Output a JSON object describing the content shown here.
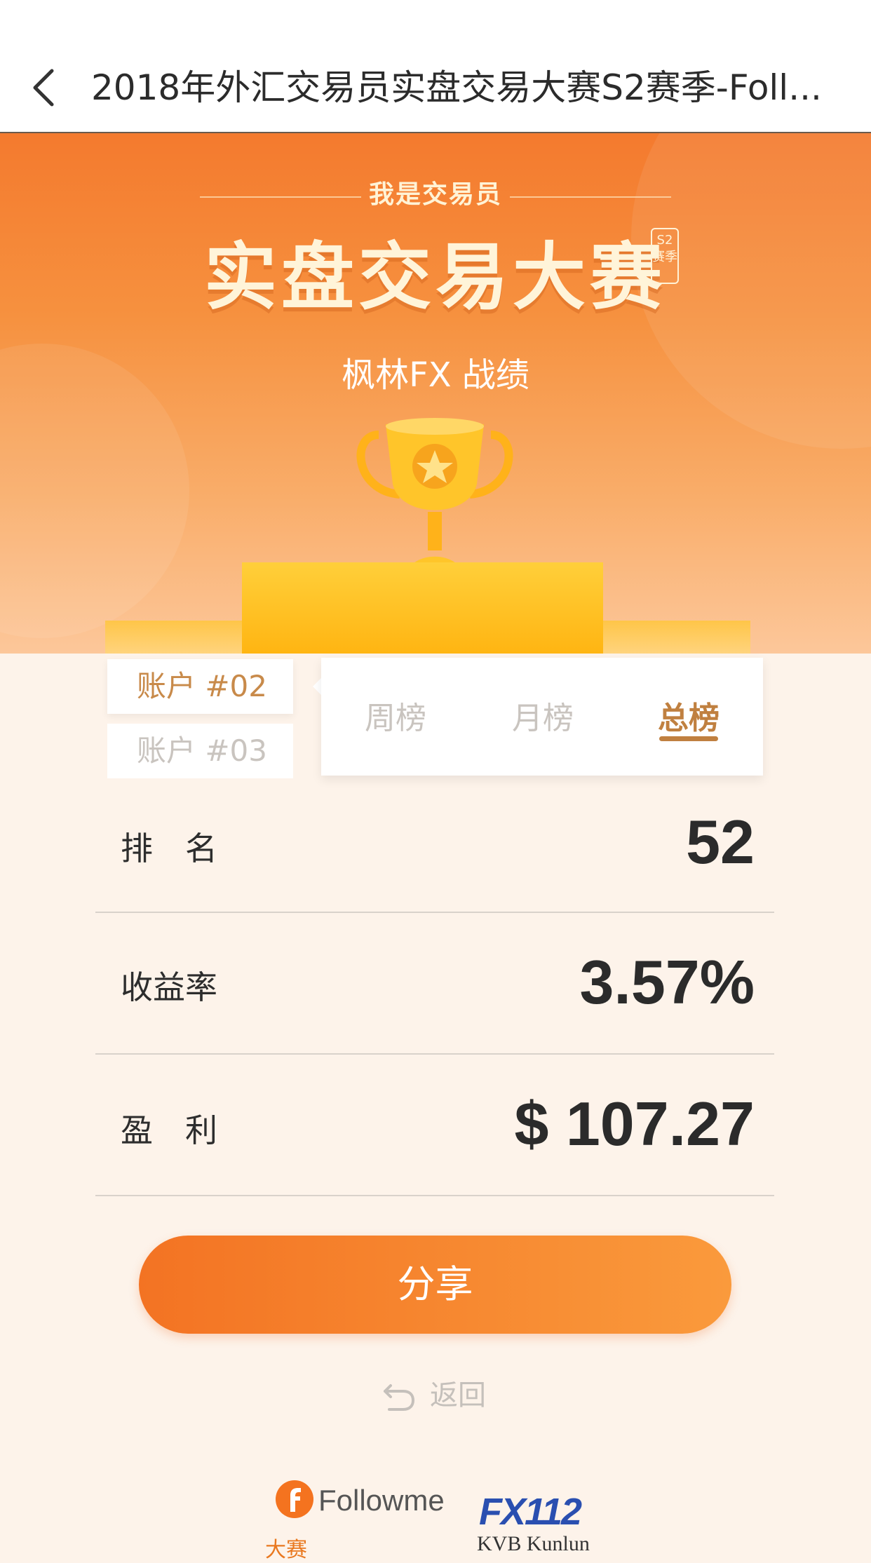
{
  "nav": {
    "title": "2018年外汇交易员实盘交易大赛S2赛季-Foll..."
  },
  "hero": {
    "brand_small": "我是交易员",
    "brand_main": "实盘交易大赛",
    "season_badge": "S2赛季",
    "subtitle": "枫林FX 战绩"
  },
  "accounts": [
    {
      "label": "账户 #02",
      "active": true
    },
    {
      "label": "账户 #03",
      "active": false
    }
  ],
  "period_tabs": [
    {
      "label": "周榜",
      "active": false
    },
    {
      "label": "月榜",
      "active": false
    },
    {
      "label": "总榜",
      "active": true
    }
  ],
  "stats": [
    {
      "label": "排　名",
      "value": "52"
    },
    {
      "label": "收益率",
      "value": "3.57%"
    },
    {
      "label": "盈　利",
      "value": "$ 107.27"
    }
  ],
  "share_label": "分享",
  "return_label": "返回",
  "sponsors": {
    "followme": "Followme",
    "fx": "FX112",
    "partial_left": "大赛",
    "partial_right": "KVB Kunlun"
  },
  "colors": {
    "accent_orange": "#f47a2e",
    "tab_active": "#c08040",
    "account_active": "#c88a4a"
  }
}
